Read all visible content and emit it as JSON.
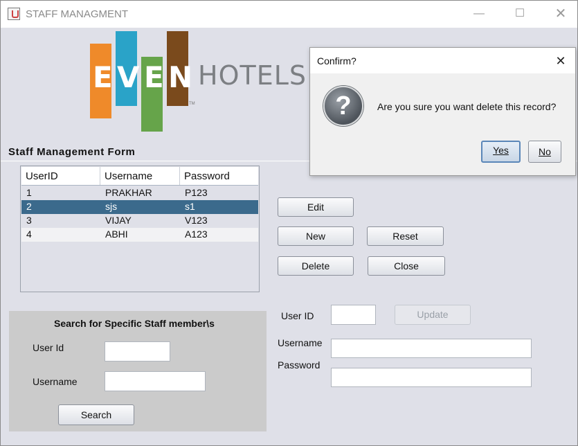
{
  "window": {
    "title": "STAFF MANAGMENT",
    "controls": [
      "minimize",
      "maximize",
      "close"
    ]
  },
  "logo": {
    "letters": [
      "E",
      "V",
      "E",
      "N"
    ],
    "text": "HOTELS",
    "tm": "TM",
    "colors": [
      "#ef8a2a",
      "#2aa3c8",
      "#66a44a",
      "#7a4a1c"
    ]
  },
  "form": {
    "title": "Staff Management Form"
  },
  "table": {
    "columns": [
      "UserID",
      "Username",
      "Password"
    ],
    "rows": [
      [
        "1",
        "PRAKHAR",
        "P123"
      ],
      [
        "2",
        "sjs",
        "s1"
      ],
      [
        "3",
        "VIJAY",
        "V123"
      ],
      [
        "4",
        "ABHI",
        "A123"
      ]
    ],
    "selected_row": 2
  },
  "actions": {
    "edit": "Edit",
    "new": "New",
    "reset": "Reset",
    "delete": "Delete",
    "close": "Close",
    "update": "Update"
  },
  "edit_form": {
    "user_id_label": "User ID",
    "username_label": "Username",
    "password_label": "Password",
    "user_id_value": "",
    "username_value": "",
    "password_value": ""
  },
  "search": {
    "title": "Search for Specific Staff member\\s",
    "user_id_label": "User Id",
    "username_label": "Username",
    "button": "Search",
    "user_id_value": "",
    "username_value": ""
  },
  "dialog": {
    "title": "Confirm?",
    "message": "Are you sure you want delete this record?",
    "yes": "Yes",
    "no": "No",
    "icon": "question-icon"
  },
  "colors": {
    "selection": "#3b6a8c",
    "window_bg": "#dfe0e8",
    "search_panel_bg": "#cbcbcb"
  }
}
